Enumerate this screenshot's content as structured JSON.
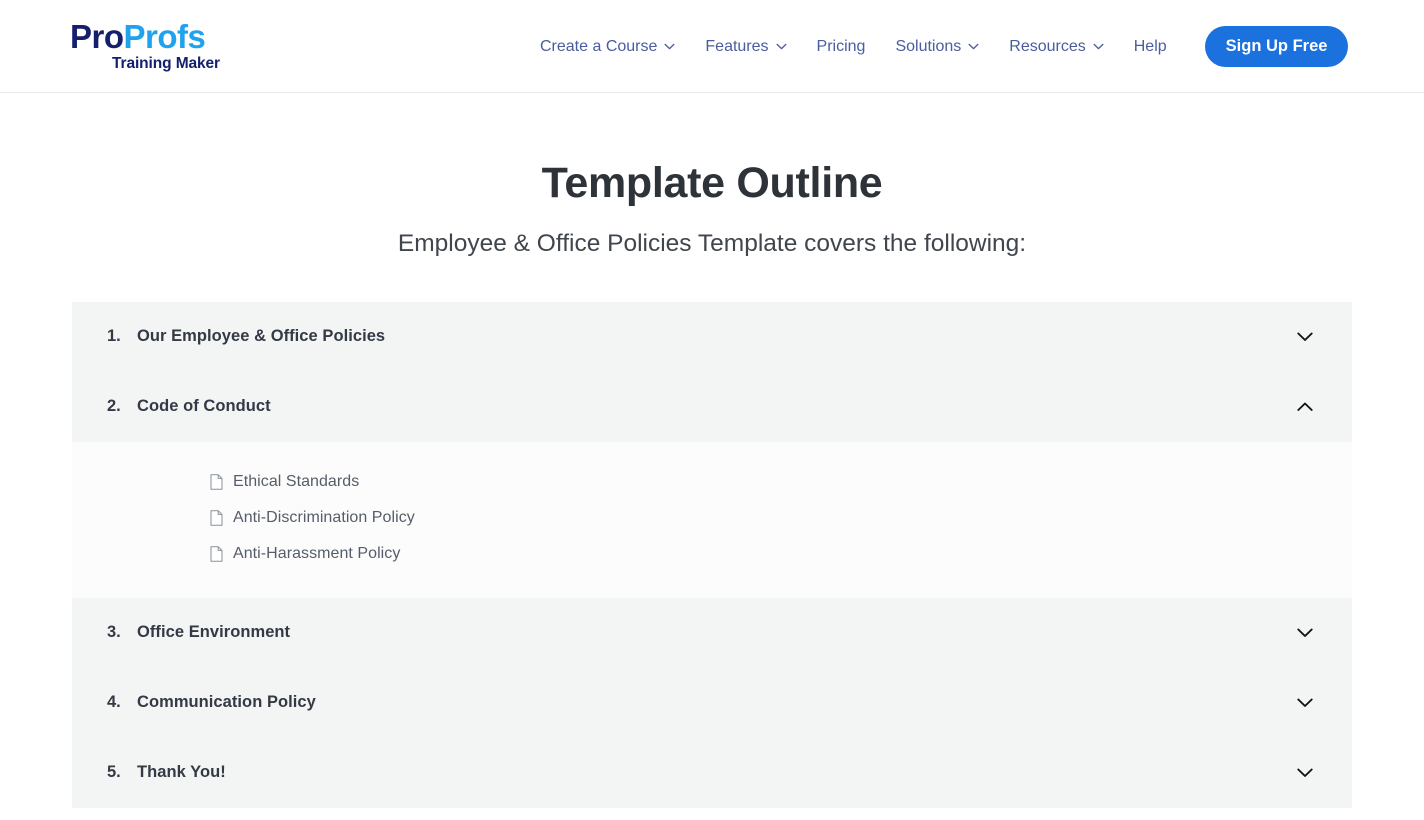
{
  "header": {
    "brand": {
      "name_part1": "Pro",
      "name_part2": "Profs",
      "tagline": "Training Maker"
    },
    "nav": [
      {
        "label": "Create a Course",
        "has_dropdown": true,
        "icon": "chevron-down-icon"
      },
      {
        "label": "Features",
        "has_dropdown": true,
        "icon": "chevron-down-icon"
      },
      {
        "label": "Pricing",
        "has_dropdown": false,
        "icon": ""
      },
      {
        "label": "Solutions",
        "has_dropdown": true,
        "icon": "chevron-down-icon"
      },
      {
        "label": "Resources",
        "has_dropdown": true,
        "icon": "chevron-down-icon"
      },
      {
        "label": "Help",
        "has_dropdown": false,
        "icon": ""
      }
    ],
    "cta": {
      "label": "Sign Up Free",
      "color": "#1b71dd"
    }
  },
  "main": {
    "title": "Template Outline",
    "subtitle": "Employee & Office Policies Template covers the following:",
    "outline": [
      {
        "number": "1.",
        "title": "Our Employee & Office Policies",
        "expanded": false,
        "toggle_icon": "chevron-down-icon",
        "children": []
      },
      {
        "number": "2.",
        "title": "Code of Conduct",
        "expanded": true,
        "toggle_icon": "chevron-up-icon",
        "children": [
          {
            "label": "Ethical Standards",
            "icon": "document-icon"
          },
          {
            "label": "Anti-Discrimination Policy",
            "icon": "document-icon"
          },
          {
            "label": "Anti-Harassment Policy",
            "icon": "document-icon"
          }
        ]
      },
      {
        "number": "3.",
        "title": "Office Environment",
        "expanded": false,
        "toggle_icon": "chevron-down-icon",
        "children": []
      },
      {
        "number": "4.",
        "title": "Communication Policy",
        "expanded": false,
        "toggle_icon": "chevron-down-icon",
        "children": []
      },
      {
        "number": "5.",
        "title": "Thank You!",
        "expanded": false,
        "toggle_icon": "chevron-down-icon",
        "children": []
      }
    ]
  },
  "colors": {
    "brand_dark": "#14206b",
    "brand_light": "#1fa3ef",
    "nav_text": "#4a5d9e",
    "cta_bg": "#1b71dd",
    "panel_bg": "#f3f4f4",
    "panel_open_bg": "#fcfcfd"
  }
}
